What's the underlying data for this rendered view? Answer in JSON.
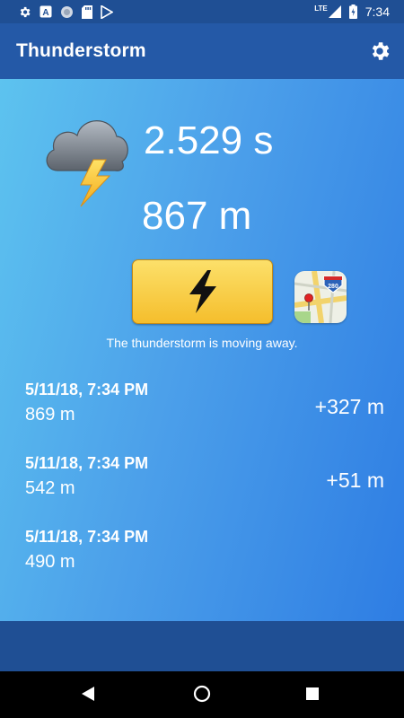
{
  "status_bar": {
    "time": "7:34",
    "network": "LTE",
    "icons": [
      "gear-icon",
      "a-notification-icon",
      "circle-icon",
      "sd-card-icon",
      "play-store-icon",
      "signal-icon",
      "battery-charging-icon"
    ]
  },
  "app_bar": {
    "title": "Thunderstorm",
    "settings_icon": "gear-icon"
  },
  "measurement": {
    "time": "2.529 s",
    "distance": "867 m"
  },
  "buttons": {
    "strike_icon": "lightning-bolt-icon",
    "map_icon": "maps-icon",
    "map_badge": "280"
  },
  "status_message": "The thunderstorm is moving away.",
  "history": [
    {
      "datetime": "5/11/18, 7:34 PM",
      "distance": "869 m",
      "difference": "+327 m"
    },
    {
      "datetime": "5/11/18, 7:34 PM",
      "distance": "542 m",
      "difference": "+51 m"
    },
    {
      "datetime": "5/11/18, 7:34 PM",
      "distance": "490 m",
      "difference": ""
    }
  ],
  "colors": {
    "status_bar": "#1f4f94",
    "app_bar": "#2459a7",
    "gradient_start": "#5dc3ef",
    "gradient_end": "#2e7de3",
    "button_yellow": "#f7c93e"
  },
  "nav_bar": {
    "icons": [
      "back-icon",
      "home-icon",
      "recents-icon"
    ]
  }
}
